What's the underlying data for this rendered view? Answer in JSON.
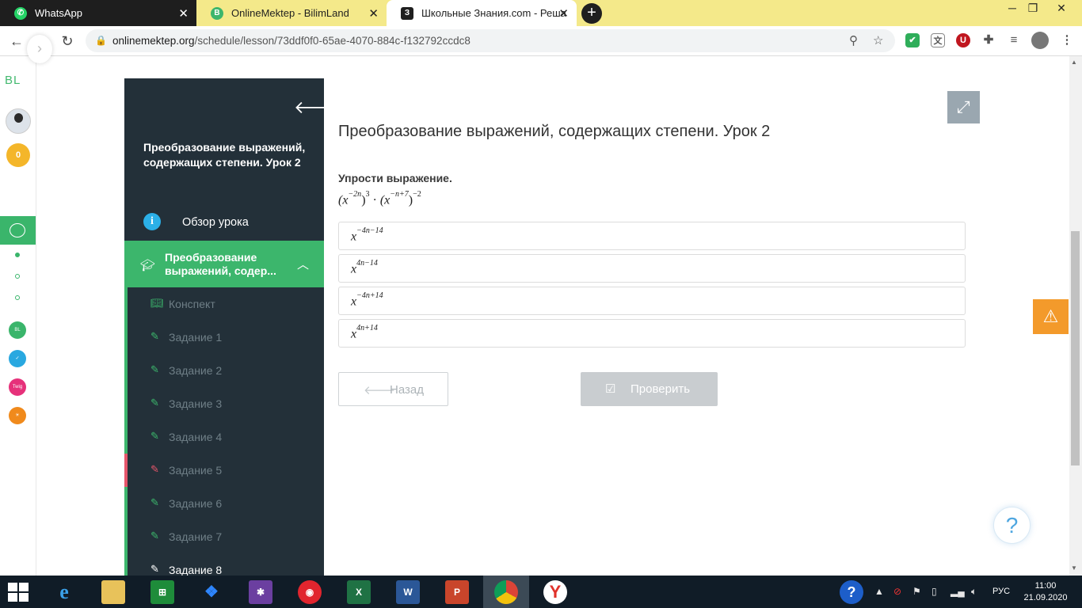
{
  "browser": {
    "tabs": [
      {
        "title": "WhatsApp",
        "favicon": "whatsapp-icon",
        "color": "#25d366"
      },
      {
        "title": "OnlineMektep - BilimLand",
        "favicon": "bilimland-icon",
        "color": "#3cb66c"
      },
      {
        "title": "Школьные Знания.com - Решае",
        "favicon": "znanija-icon",
        "color": "#1f1f1f"
      }
    ],
    "tab_close": "✕",
    "new_tab": "+",
    "url_host": "onlinemektep.org",
    "url_path": "/schedule/lesson/73ddf0f0-65ae-4070-884c-f132792ccdc8"
  },
  "rail": {
    "logo": "BL",
    "coins": "0"
  },
  "lesson": {
    "title": "Преобразование выражений, содержащих степени. Урок 2",
    "overview_label": "Обзор урока",
    "section_label": "Преобразование выражений, содер...",
    "items": [
      {
        "label": "Конспект",
        "state": "default",
        "icon": "book-icon"
      },
      {
        "label": "Задание 1",
        "state": "default",
        "icon": "edit-icon"
      },
      {
        "label": "Задание 2",
        "state": "default",
        "icon": "edit-icon"
      },
      {
        "label": "Задание 3",
        "state": "default",
        "icon": "edit-icon"
      },
      {
        "label": "Задание 4",
        "state": "default",
        "icon": "edit-icon"
      },
      {
        "label": "Задание 5",
        "state": "error",
        "icon": "edit-icon"
      },
      {
        "label": "Задание 6",
        "state": "default",
        "icon": "edit-icon"
      },
      {
        "label": "Задание 7",
        "state": "default",
        "icon": "edit-icon"
      },
      {
        "label": "Задание 8",
        "state": "current",
        "icon": "edit-icon"
      }
    ]
  },
  "main": {
    "title": "Преобразование выражений, содержащих степени. Урок 2",
    "prompt": "Упрости выражение.",
    "expression": {
      "base1": "(x",
      "exp1": "−2n",
      "close1": ")",
      "pow1": "3",
      "dot": " · ",
      "base2": "(x",
      "exp2": "−n+7",
      "close2": ")",
      "pow2": "−2"
    },
    "options": [
      {
        "base": "x",
        "exp": "−4n−14"
      },
      {
        "base": "x",
        "exp": "4n−14"
      },
      {
        "base": "x",
        "exp": "−4n+14"
      },
      {
        "base": "x",
        "exp": "4n+14"
      }
    ],
    "back_label": "Назад",
    "check_label": "Проверить"
  },
  "taskbar": {
    "lang": "РУС",
    "time": "11:00",
    "date": "21.09.2020"
  },
  "colors": {
    "sidebar_bg": "#233039",
    "accent_green": "#3cb66c",
    "error_red": "#e5566b",
    "warning_orange": "#f39a2b",
    "tab_strip": "#f4e98a"
  }
}
